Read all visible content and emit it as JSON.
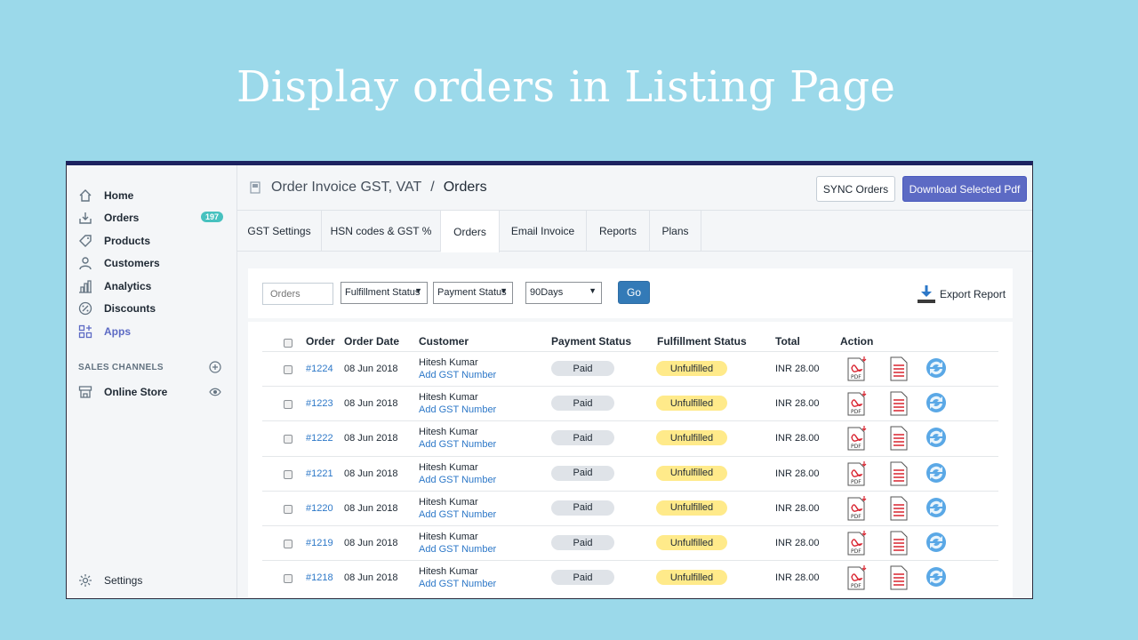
{
  "slide": {
    "title": "Display orders in Listing Page"
  },
  "sidebar": {
    "items": [
      {
        "label": "Home",
        "icon": "home-icon"
      },
      {
        "label": "Orders",
        "icon": "orders-icon",
        "badge": "197"
      },
      {
        "label": "Products",
        "icon": "tag-icon"
      },
      {
        "label": "Customers",
        "icon": "person-icon"
      },
      {
        "label": "Analytics",
        "icon": "bar-chart-icon"
      },
      {
        "label": "Discounts",
        "icon": "discount-icon"
      },
      {
        "label": "Apps",
        "icon": "apps-icon",
        "active": true
      }
    ],
    "sales_channels_label": "SALES CHANNELS",
    "online_store": "Online Store",
    "settings": "Settings"
  },
  "header": {
    "app_name": "Order Invoice GST, VAT",
    "separator": "/",
    "page": "Orders",
    "sync_button": "SYNC Orders",
    "download_button": "Download Selected Pdf"
  },
  "tabs": [
    "GST Settings",
    "HSN codes & GST %",
    "Orders",
    "Email Invoice",
    "Reports",
    "Plans"
  ],
  "active_tab": "Orders",
  "filters": {
    "orders_placeholder": "Orders",
    "fulfillment": "Fulfillment Status",
    "payment": "Payment Status",
    "range": "90Days",
    "go": "Go",
    "export": "Export Report"
  },
  "table": {
    "columns": [
      "Order",
      "Order Date",
      "Customer",
      "Payment Status",
      "Fulfillment Status",
      "Total",
      "Action"
    ],
    "rows": [
      {
        "order": "#1224",
        "date": "08 Jun 2018",
        "customer": "Hitesh Kumar",
        "gst_link": "Add GST Number",
        "payment": "Paid",
        "fulfillment": "Unfulfilled",
        "total": "INR 28.00"
      },
      {
        "order": "#1223",
        "date": "08 Jun 2018",
        "customer": "Hitesh Kumar",
        "gst_link": "Add GST Number",
        "payment": "Paid",
        "fulfillment": "Unfulfilled",
        "total": "INR 28.00"
      },
      {
        "order": "#1222",
        "date": "08 Jun 2018",
        "customer": "Hitesh Kumar",
        "gst_link": "Add GST Number",
        "payment": "Paid",
        "fulfillment": "Unfulfilled",
        "total": "INR 28.00"
      },
      {
        "order": "#1221",
        "date": "08 Jun 2018",
        "customer": "Hitesh Kumar",
        "gst_link": "Add GST Number",
        "payment": "Paid",
        "fulfillment": "Unfulfilled",
        "total": "INR 28.00"
      },
      {
        "order": "#1220",
        "date": "08 Jun 2018",
        "customer": "Hitesh Kumar",
        "gst_link": "Add GST Number",
        "payment": "Paid",
        "fulfillment": "Unfulfilled",
        "total": "INR 28.00"
      },
      {
        "order": "#1219",
        "date": "08 Jun 2018",
        "customer": "Hitesh Kumar",
        "gst_link": "Add GST Number",
        "payment": "Paid",
        "fulfillment": "Unfulfilled",
        "total": "INR 28.00"
      },
      {
        "order": "#1218",
        "date": "08 Jun 2018",
        "customer": "Hitesh Kumar",
        "gst_link": "Add GST Number",
        "payment": "Paid",
        "fulfillment": "Unfulfilled",
        "total": "INR 28.00"
      }
    ]
  },
  "colors": {
    "background": "#9bd9ea",
    "accent": "#5c6ac4",
    "go_button": "#337ab7",
    "badge": "#47c1bf",
    "unfulfilled": "#ffea8a",
    "paid": "#dfe3e8",
    "link": "#2d78c8"
  }
}
